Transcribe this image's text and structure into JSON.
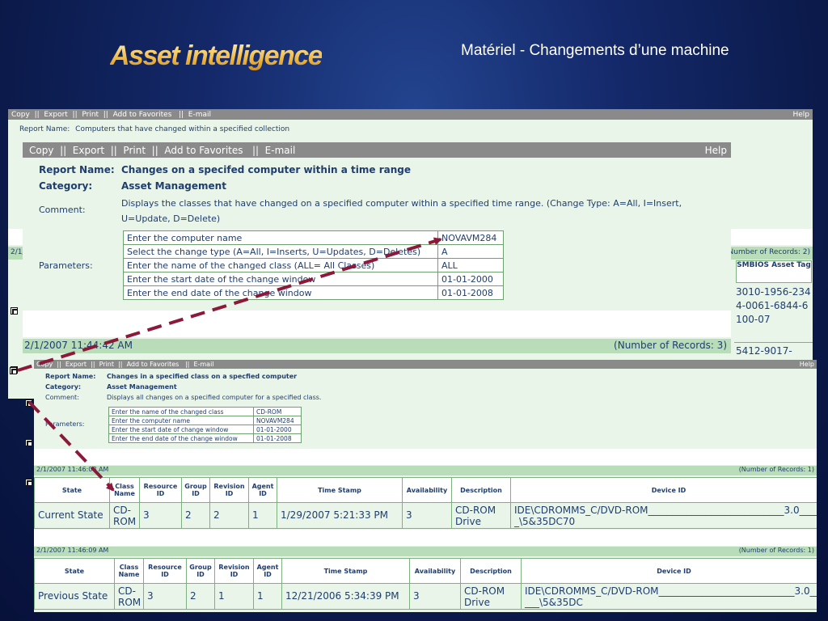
{
  "slide": {
    "logo": "Asset intelligence",
    "title": "Matériel - Changements d’une machine"
  },
  "back_window": {
    "toolbar": {
      "copy": "Copy",
      "export": "Export",
      "print": "Print",
      "favorites": "Add to Favorites",
      "email": "E-mail",
      "help": "Help"
    },
    "report_name_label": "Report Name:",
    "report_name": "Computers that have changed within a specified collection",
    "category_label": "Category:",
    "category": "Asset Management",
    "date_fragment": "2/1/",
    "records": "(Number of Records: 2)",
    "col_smbios": "SMBIOS Asset Tag",
    "smbios_values": [
      "3010-1956-2344-0061-6844-6100-07",
      "5412-9017-"
    ]
  },
  "mid_window": {
    "toolbar": {
      "copy": "Copy",
      "export": "Export",
      "print": "Print",
      "favorites": "Add to Favorites",
      "email": "E-mail",
      "help": "Help"
    },
    "report_name_label": "Report Name:",
    "report_name": "Changes on a specifed computer within a time range",
    "category_label": "Category:",
    "category": "Asset Management",
    "comment_label": "Comment:",
    "comment": "Displays the classes that have changed on a specified computer within a specified time range. (Change Type: A=All, I=Insert, U=Update, D=Delete)",
    "parameters_label": "Parameters:",
    "params": [
      {
        "name": "Enter the computer name",
        "value": "NOVAVM284"
      },
      {
        "name": "Select the change type (A=All, I=Inserts, U=Updates, D=Deletes)",
        "value": "A"
      },
      {
        "name": "Enter the name of the changed class (ALL= All Classes)",
        "value": "ALL"
      },
      {
        "name": "Enter the start date of the change window",
        "value": "01-01-2000"
      },
      {
        "name": "Enter the end date of the change window",
        "value": "01-01-2008"
      }
    ],
    "bar_date": "2/1/2007 11:44:42 AM",
    "records": "(Number of Records: 3)"
  },
  "front_window": {
    "toolbar": {
      "copy": "Copy",
      "export": "Export",
      "print": "Print",
      "favorites": "Add to Favorites",
      "email": "E-mail",
      "help": "Help"
    },
    "report_name_label": "Report Name:",
    "report_name": "Changes in a specified class on a specfied computer",
    "category_label": "Category:",
    "category": "Asset Management",
    "comment_label": "Comment:",
    "comment": "Displays all changes on a specified computer for a specified class.",
    "parameters_label": "Parameters:",
    "params": [
      {
        "name": "Enter the name of the changed class",
        "value": "CD-ROM"
      },
      {
        "name": "Enter the computer name",
        "value": "NOVAVM284"
      },
      {
        "name": "Enter the start date of change window",
        "value": "01-01-2000"
      },
      {
        "name": "Enter the end date of the change window",
        "value": "01-01-2008"
      }
    ],
    "headers": [
      "State",
      "Class Name",
      "Resource ID",
      "Group ID",
      "Revision ID",
      "Agent ID",
      "Time Stamp",
      "Availability",
      "Description",
      "Device ID"
    ],
    "sections": [
      {
        "date": "2/1/2007 11:46:08 AM",
        "records": "(Number of Records: 1)",
        "row": [
          "Current State",
          "CD-ROM",
          "3",
          "2",
          "2",
          "1",
          "1/29/2007 5:21:33 PM",
          "3",
          "CD-ROM Drive",
          "IDE\\CDROMMS_C/DVD-ROM____________________________3.0_____\\5&35DC70"
        ]
      },
      {
        "date": "2/1/2007 11:46:09 AM",
        "records": "(Number of Records: 1)",
        "row": [
          "Previous State",
          "CD-ROM",
          "3",
          "2",
          "1",
          "1",
          "12/21/2006 5:34:39 PM",
          "3",
          "CD-ROM Drive",
          "IDE\\CDROMMS_C/DVD-ROM____________________________3.0_____\\5&35DC"
        ]
      }
    ]
  },
  "colors": {
    "toolbar": "#8a8a8a",
    "panel": "#eaf5ea",
    "bar": "#b8ddb8",
    "text": "#1f3e6e",
    "arrow": "#8b1a3a"
  }
}
